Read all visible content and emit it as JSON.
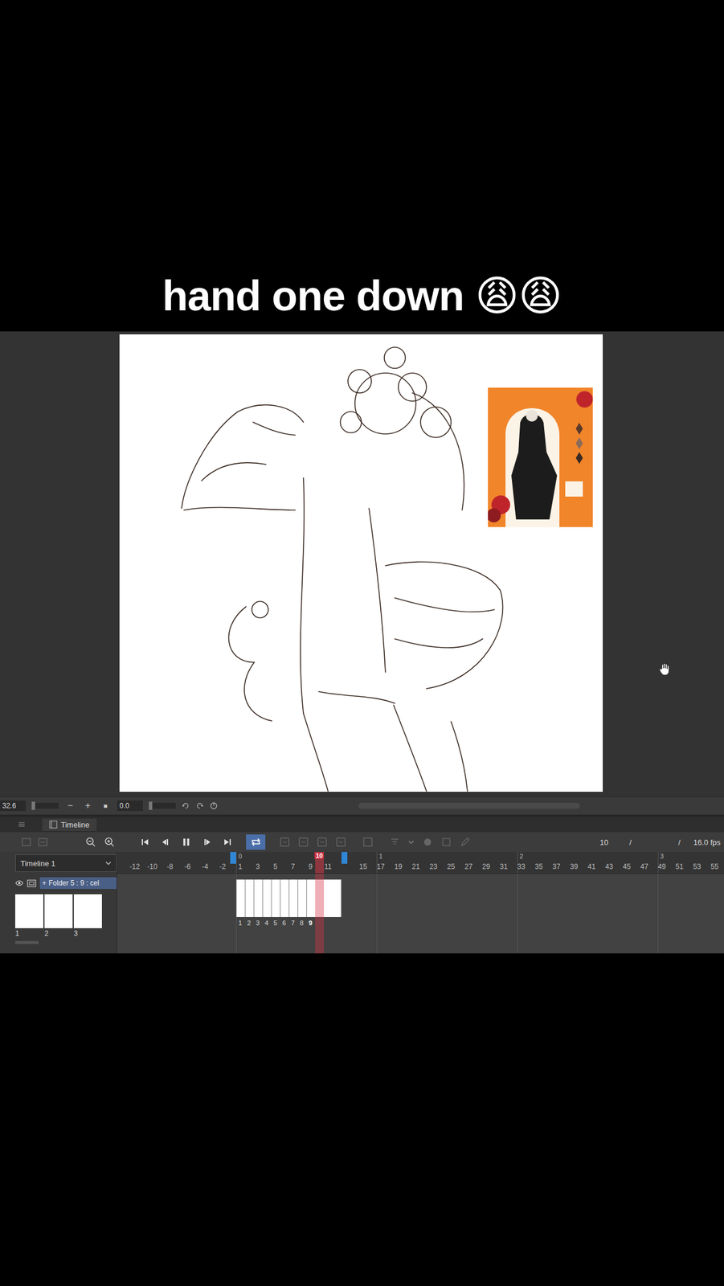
{
  "caption": "hand one down 😩😩",
  "status_bar": {
    "zoom": "32.6",
    "zoom_out": "−",
    "zoom_in": "+",
    "stop": "■",
    "rotation": "0.0"
  },
  "timeline": {
    "tab": "Timeline",
    "selector": "Timeline 1",
    "current_frame": "10",
    "separator": "/",
    "end_separator": "/",
    "fps": "16.0 fps",
    "playing": true,
    "loop": true,
    "playhead": "10",
    "seconds": [
      "0",
      "1",
      "2",
      "3"
    ],
    "ruler": [
      "-12",
      "-10",
      "-8",
      "-6",
      "-4",
      "-2",
      "1",
      "3",
      "5",
      "7",
      "9",
      "11",
      "15",
      "17",
      "19",
      "21",
      "23",
      "25",
      "27",
      "29",
      "31",
      "33",
      "35",
      "37",
      "39",
      "41",
      "43",
      "45",
      "47",
      "49",
      "51",
      "53",
      "55"
    ],
    "layers": [
      {
        "expander": "+",
        "name": "Folder 5 : 9 : cel",
        "visible": true,
        "selected": true,
        "thumbnails": [
          "1",
          "2",
          "3"
        ],
        "hold_frames": 3,
        "cels": [
          {
            "label": "1",
            "selected": false
          },
          {
            "label": "2",
            "selected": false
          },
          {
            "label": "3",
            "selected": false
          },
          {
            "label": "4",
            "selected": false
          },
          {
            "label": "5",
            "selected": false
          },
          {
            "label": "6",
            "selected": false
          },
          {
            "label": "7",
            "selected": false
          },
          {
            "label": "8",
            "selected": false
          },
          {
            "label": "9",
            "selected": true
          }
        ]
      }
    ]
  }
}
